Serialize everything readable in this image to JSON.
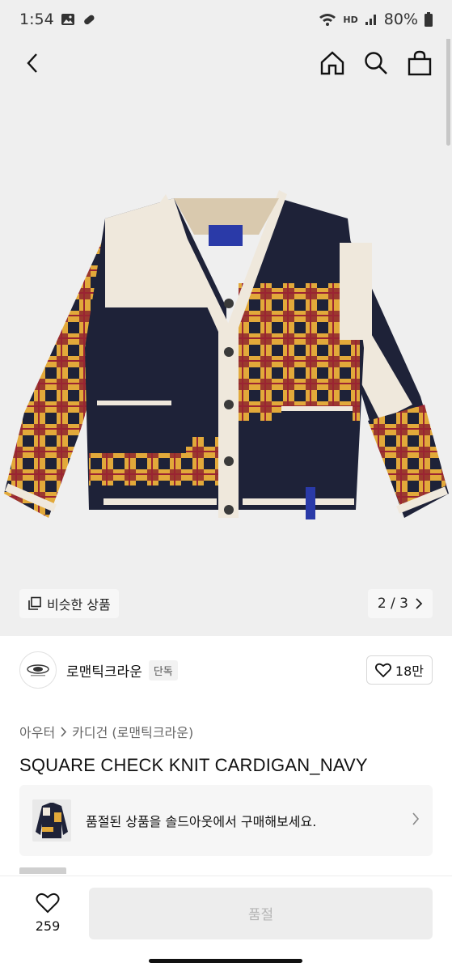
{
  "status_bar": {
    "time": "1:54",
    "battery": "80%",
    "network_label": "HD",
    "icons": [
      "gallery-icon",
      "pill-icon",
      "wifi-icon",
      "signal-icon",
      "battery-icon"
    ]
  },
  "nav": {
    "icons": [
      "back-icon",
      "home-icon",
      "search-icon",
      "shopping-bag-icon"
    ]
  },
  "gallery": {
    "similar_label": "비슷한 상품",
    "page_indicator": "2 / 3"
  },
  "brand": {
    "name": "로맨틱크라운",
    "badge": "단독",
    "likes": "18만"
  },
  "breadcrumb": {
    "level1": "아우터",
    "level2": "카디건 (로맨틱크라운)"
  },
  "product": {
    "title": "SQUARE CHECK KNIT CARDIGAN_NAVY"
  },
  "soldout_banner": {
    "text": "품절된 상품을 솔드아웃에서 구매해보세요."
  },
  "bottom_bar": {
    "wish_count": "259",
    "soldout_label": "품절"
  },
  "colors": {
    "navy": "#1e2238",
    "cream": "#efe8dc",
    "mustard": "#e2a93a",
    "red": "#9a2432",
    "background": "#efefef",
    "disabled_text": "#b5b5b5"
  }
}
